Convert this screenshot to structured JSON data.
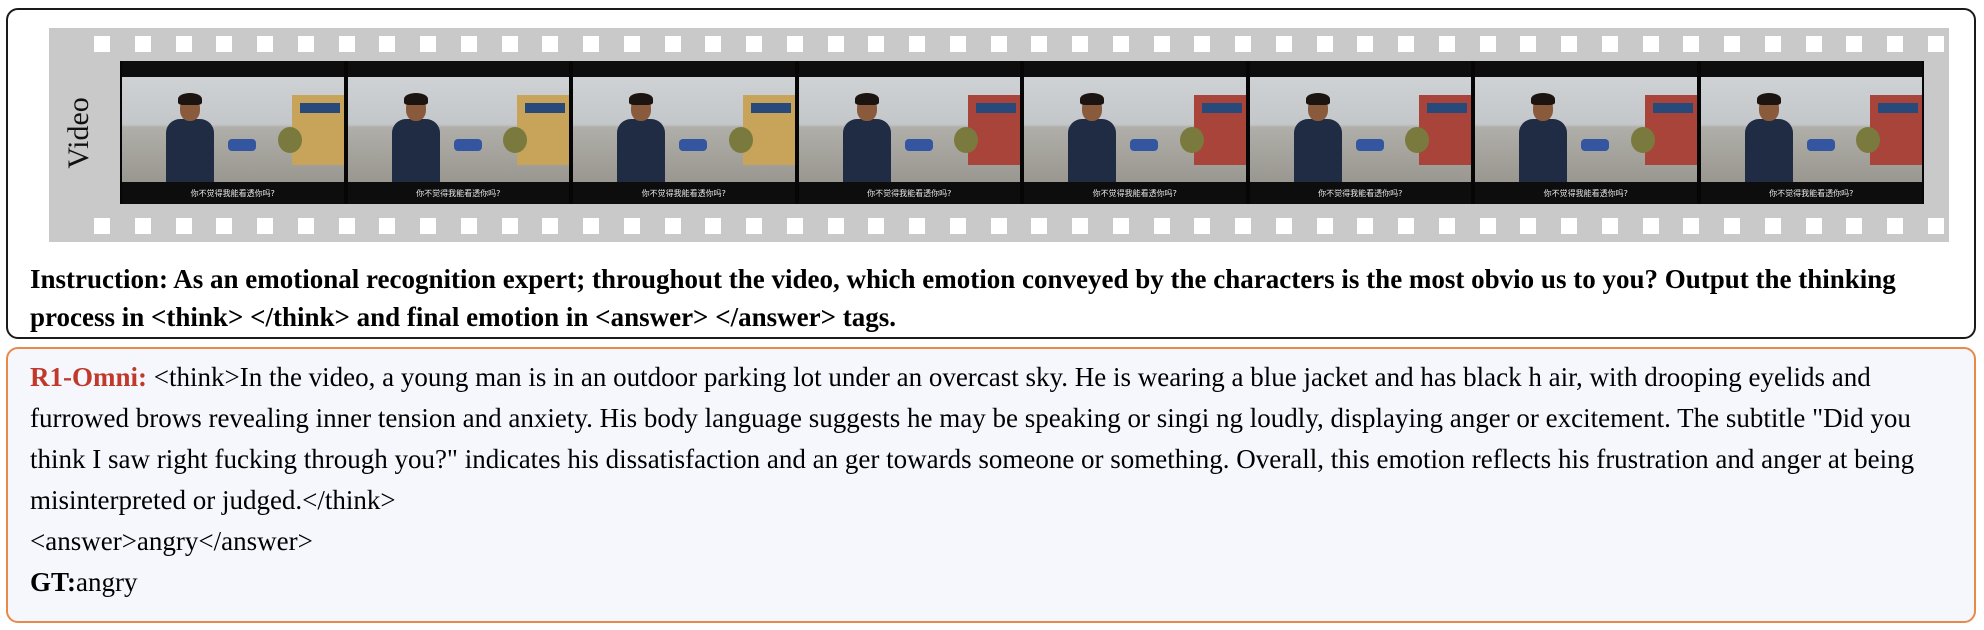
{
  "video_panel": {
    "label": "Video",
    "frames": [
      {
        "subtitle": "你不觉得我能看透你吗?",
        "building": "yellow"
      },
      {
        "subtitle": "你不觉得我能看透你吗?",
        "building": "yellow"
      },
      {
        "subtitle": "你不觉得我能看透你吗?",
        "building": "yellow"
      },
      {
        "subtitle": "你不觉得我能看透你吗?",
        "building": "red"
      },
      {
        "subtitle": "你不觉得我能看透你吗?",
        "building": "red"
      },
      {
        "subtitle": "你不觉得我能看透你吗?",
        "building": "red"
      },
      {
        "subtitle": "你不觉得我能看透你吗?",
        "building": "red"
      },
      {
        "subtitle": "你不觉得我能看透你吗?",
        "building": "red"
      }
    ]
  },
  "instruction": "Instruction: As an emotional recognition expert; throughout the video, which emotion conveyed by the characters is the most obvio us to you?  Output the thinking process in <think> </think> and final emotion in <answer> </answer> tags.",
  "response": {
    "model_name": "R1-Omni:",
    "think_text": " <think>In the video, a young man is in an outdoor parking lot under an overcast sky. He is wearing a blue jacket and has black h air, with drooping eyelids and furrowed brows revealing inner tension and anxiety. His body language suggests he may be speaking or singi ng loudly, displaying anger or excitement. The subtitle \"Did you think I saw right fucking through you?\" indicates his dissatisfaction and an ger towards someone or something. Overall, this emotion reflects his frustration and anger at being misinterpreted or judged.</think>",
    "answer_text": "<answer>angry</answer>",
    "gt_label": "GT:",
    "gt_value": "angry"
  },
  "colors": {
    "model_name": "#c0392b",
    "response_border": "#e8894a",
    "response_background": "#f5f7fd",
    "film_strip": "#c9c9c9"
  }
}
